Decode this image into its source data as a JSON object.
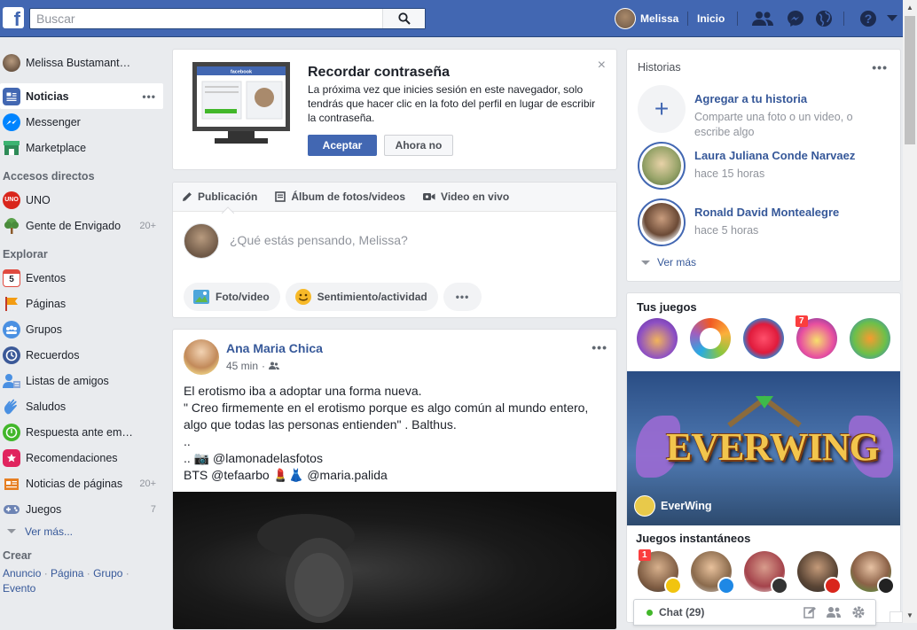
{
  "topbar": {
    "logo": "f",
    "search_placeholder": "Buscar",
    "user_name": "Melissa",
    "home_label": "Inicio",
    "bg_color": "#4267b2"
  },
  "left_nav": {
    "profile_name": "Melissa Bustamant…",
    "main_items": [
      {
        "label": "Noticias",
        "icon": "news-feed-icon",
        "active": true
      },
      {
        "label": "Messenger",
        "icon": "messenger-icon"
      },
      {
        "label": "Marketplace",
        "icon": "marketplace-icon"
      }
    ],
    "shortcuts_heading": "Accesos directos",
    "shortcuts": [
      {
        "label": "UNO",
        "icon": "uno-game-icon"
      },
      {
        "label": "Gente de Envigado",
        "icon": "group-tree-icon",
        "count": "20+"
      }
    ],
    "explore_heading": "Explorar",
    "explore": [
      {
        "label": "Eventos",
        "icon": "calendar-icon"
      },
      {
        "label": "Páginas",
        "icon": "flag-icon"
      },
      {
        "label": "Grupos",
        "icon": "groups-icon"
      },
      {
        "label": "Recuerdos",
        "icon": "clock-memories-icon"
      },
      {
        "label": "Listas de amigos",
        "icon": "friend-list-icon"
      },
      {
        "label": "Saludos",
        "icon": "wave-hand-icon"
      },
      {
        "label": "Respuesta ante em…",
        "icon": "crisis-response-icon"
      },
      {
        "label": "Recomendaciones",
        "icon": "recommendations-icon"
      },
      {
        "label": "Noticias de páginas",
        "icon": "pages-feed-icon",
        "count": "20+"
      },
      {
        "label": "Juegos",
        "icon": "gamepad-icon",
        "count": "7"
      }
    ],
    "see_more": "Ver más...",
    "create_heading": "Crear",
    "create_links": [
      "Anuncio",
      "Página",
      "Grupo",
      "Evento"
    ]
  },
  "remember_password": {
    "title": "Recordar contraseña",
    "body": "La próxima vez que inicies sesión en este navegador, solo tendrás que hacer clic en la foto del perfil en lugar de escribir la contraseña.",
    "accept": "Aceptar",
    "not_now": "Ahora no",
    "laptop_brand": "facebook",
    "close": "×"
  },
  "composer": {
    "tabs": [
      {
        "label": "Publicación",
        "icon": "pencil-icon"
      },
      {
        "label": "Álbum de fotos/videos",
        "icon": "album-icon"
      },
      {
        "label": "Video en vivo",
        "icon": "live-video-icon"
      }
    ],
    "placeholder": "¿Qué estás pensando, Melissa?",
    "actions": [
      {
        "label": "Foto/video",
        "icon": "photo-icon"
      },
      {
        "label": "Sentimiento/actividad",
        "icon": "emoji-icon"
      }
    ],
    "more": "•••"
  },
  "post": {
    "author": "Ana Maria Chica",
    "time": "45 min",
    "audience_icon": "friends-icon",
    "text_lines": [
      "El erotismo iba a adoptar una forma nueva.",
      "\" Creo firmemente en el erotismo porque es algo común al mundo entero,",
      "algo que todas las personas entienden\" . Balthus.",
      "..",
      ".. 📷 @lamonadelasfotos",
      "BTS @tefaarbo 💄👗 @maria.palida"
    ],
    "menu": "•••"
  },
  "stories": {
    "heading": "Historias",
    "menu": "•••",
    "add_title": "Agregar a tu historia",
    "add_sub": "Comparte una foto o un video, o escribe algo",
    "items": [
      {
        "name": "Laura Juliana Conde Narvaez",
        "time": "hace 15 horas"
      },
      {
        "name": "Ronald David Montealegre",
        "time": "hace 5 horas"
      }
    ],
    "see_more": "Ver más"
  },
  "games": {
    "heading": "Tus juegos",
    "icons": [
      "hero-game-icon",
      "trivia-face-icon",
      "candy-crush-icon",
      "candy-soda-icon",
      "farm-heroes-icon"
    ],
    "badge": "7",
    "banner_title": "EVERWING",
    "banner_caption": "EverWing",
    "instant_heading": "Juegos instantáneos",
    "instant_badge": "1"
  },
  "chat": {
    "label": "Chat (29)"
  }
}
